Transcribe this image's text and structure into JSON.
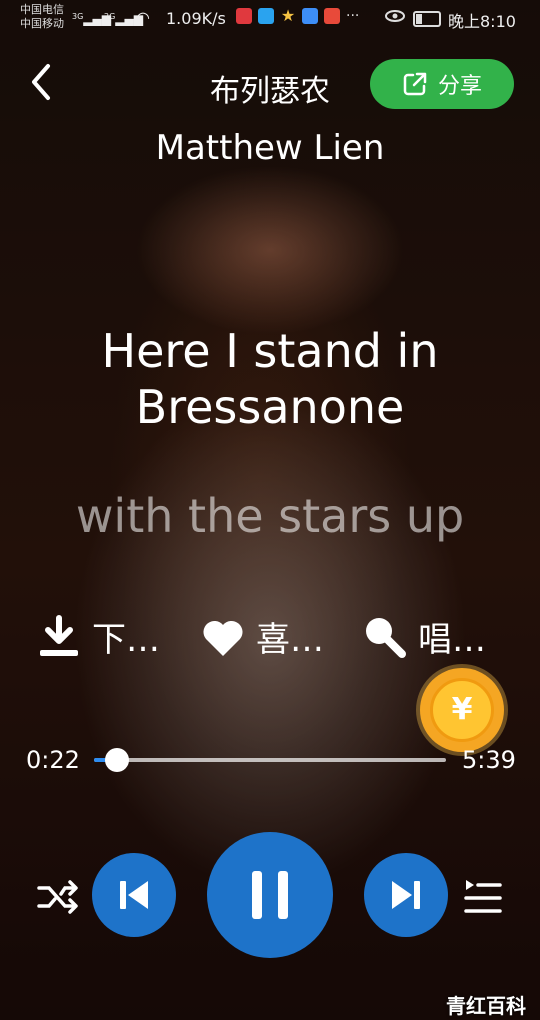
{
  "status_bar": {
    "carrier_1": "中国电信",
    "carrier_2": "中国移动",
    "network_1": "3G",
    "network_2": "2G",
    "speed": "1.09K/s",
    "more": "···",
    "time": "晚上8:10"
  },
  "header": {
    "song_title": "布列瑟农",
    "share_label": "分享",
    "artist": "Matthew Lien"
  },
  "lyrics": {
    "current": [
      "Here I stand in",
      "Bressanone"
    ],
    "next": "with the stars up"
  },
  "actions": {
    "download_label": "下…",
    "like_label": "喜…",
    "sing_label": "唱…"
  },
  "coin": {
    "symbol": "¥"
  },
  "player": {
    "current_time": "0:22",
    "total_time": "5:39",
    "progress": 0.065
  },
  "watermark": "青红百科",
  "colors": {
    "accent_blue": "#1e73c9",
    "share_green": "#32b24a",
    "progress_blue": "#2d8cf0",
    "coin_gold": "#f5a623"
  },
  "icons": {
    "back": "back-arrow-icon",
    "share": "share-icon",
    "download": "download-icon",
    "like": "heart-icon",
    "sing": "microphone-icon",
    "shuffle": "shuffle-icon",
    "prev": "skip-previous-icon",
    "pause": "pause-icon",
    "next": "skip-next-icon",
    "playlist": "playlist-icon"
  }
}
